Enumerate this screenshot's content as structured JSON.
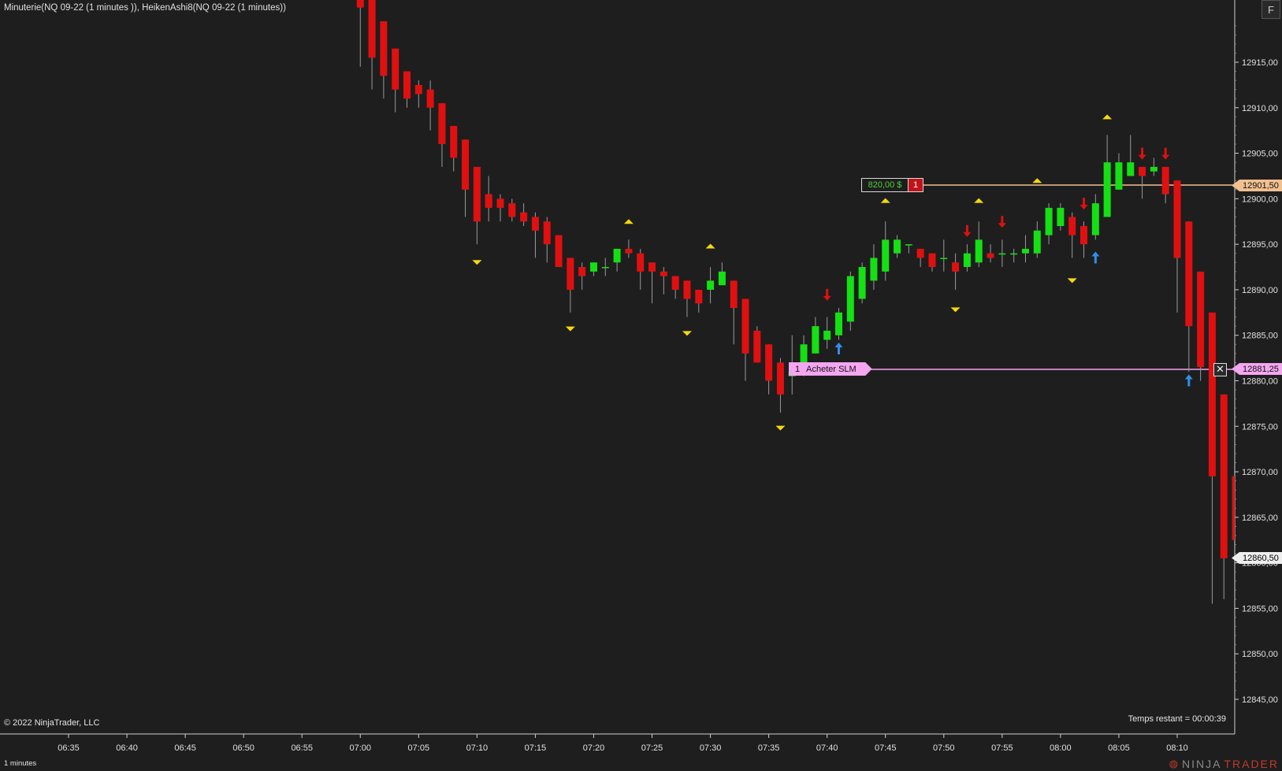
{
  "header": {
    "title": "Minuterie(NQ 09-22 (1 minutes )), HeikenAshi8(NQ 09-22 (1 minutes))",
    "f_button": "F"
  },
  "footer": {
    "copyright": "© 2022 NinjaTrader, LLC",
    "remaining": "Temps restant = 00:00:39",
    "interval": "1 minutes",
    "brand_ninja": "NINJA",
    "brand_trader": "TRADER"
  },
  "position": {
    "pnl": "820,00 $",
    "qty": "1",
    "price": 12901.5,
    "price_label": "12901,50"
  },
  "order": {
    "qty": "1",
    "label": "Acheter SLM",
    "price": 12881.25,
    "price_label": "12881,25"
  },
  "last_price": {
    "price": 12860.5,
    "label": "12860,50"
  },
  "colors": {
    "background": "#1e1e1e",
    "up": "#14e014",
    "down": "#e01010",
    "wick": "#9a9a9a",
    "position_line": "#f0c090",
    "order_line": "#f4a6f0",
    "marker_yellow": "#f5d90a",
    "arrow_blue": "#2f8ff0",
    "arrow_red": "#e01010"
  },
  "chart_data": {
    "type": "candlestick",
    "ylim": [
      12841,
      12922
    ],
    "y_ticks": [
      "12915,00",
      "12910,00",
      "12905,00",
      "12900,00",
      "12895,00",
      "12890,00",
      "12885,00",
      "12880,00",
      "12875,00",
      "12870,00",
      "12865,00",
      "12860,00",
      "12855,00",
      "12850,00",
      "12845,00"
    ],
    "y_tick_values": [
      12915,
      12910,
      12905,
      12900,
      12895,
      12890,
      12885,
      12880,
      12875,
      12870,
      12865,
      12860,
      12855,
      12850,
      12845
    ],
    "x_ticks": [
      "06:35",
      "06:40",
      "06:45",
      "06:50",
      "06:55",
      "07:00",
      "07:05",
      "07:10",
      "07:15",
      "07:20",
      "07:25",
      "07:30",
      "07:35",
      "07:40",
      "07:45",
      "07:50",
      "07:55",
      "08:00",
      "08:05",
      "08:10"
    ],
    "x_tick_minutes": [
      395,
      400,
      405,
      410,
      415,
      420,
      425,
      430,
      435,
      440,
      445,
      450,
      455,
      460,
      465,
      470,
      475,
      480,
      485,
      490
    ],
    "grid": false,
    "candles": [
      {
        "t": 420,
        "o": 12925.0,
        "h": 12925.0,
        "l": 12914.5,
        "c": 12921.0
      },
      {
        "t": 421,
        "o": 12925.0,
        "h": 12925.0,
        "l": 12912.0,
        "c": 12915.5
      },
      {
        "t": 422,
        "o": 12919.5,
        "h": 12919.5,
        "l": 12911.0,
        "c": 12913.5
      },
      {
        "t": 423,
        "o": 12916.5,
        "h": 12916.5,
        "l": 12909.5,
        "c": 12912.0
      },
      {
        "t": 424,
        "o": 12914.0,
        "h": 12914.0,
        "l": 12910.0,
        "c": 12911.0
      },
      {
        "t": 425,
        "o": 12912.5,
        "h": 12913.0,
        "l": 12910.0,
        "c": 12911.5
      },
      {
        "t": 426,
        "o": 12912.0,
        "h": 12913.0,
        "l": 12907.5,
        "c": 12910.0
      },
      {
        "t": 427,
        "o": 12910.5,
        "h": 12910.5,
        "l": 12903.5,
        "c": 12906.0
      },
      {
        "t": 428,
        "o": 12908.0,
        "h": 12908.0,
        "l": 12903.0,
        "c": 12904.5
      },
      {
        "t": 429,
        "o": 12906.5,
        "h": 12906.5,
        "l": 12898.0,
        "c": 12901.0
      },
      {
        "t": 430,
        "o": 12903.5,
        "h": 12903.5,
        "l": 12895.0,
        "c": 12897.5
      },
      {
        "t": 431,
        "o": 12900.5,
        "h": 12902.5,
        "l": 12897.5,
        "c": 12899.0
      },
      {
        "t": 432,
        "o": 12900.0,
        "h": 12900.5,
        "l": 12897.5,
        "c": 12899.0
      },
      {
        "t": 433,
        "o": 12899.5,
        "h": 12900.0,
        "l": 12897.5,
        "c": 12898.0
      },
      {
        "t": 434,
        "o": 12898.5,
        "h": 12899.5,
        "l": 12897.0,
        "c": 12897.5
      },
      {
        "t": 435,
        "o": 12898.0,
        "h": 12898.5,
        "l": 12893.5,
        "c": 12896.5
      },
      {
        "t": 436,
        "o": 12897.5,
        "h": 12898.0,
        "l": 12893.0,
        "c": 12895.0
      },
      {
        "t": 437,
        "o": 12896.0,
        "h": 12896.0,
        "l": 12892.5,
        "c": 12892.5
      },
      {
        "t": 438,
        "o": 12893.5,
        "h": 12893.5,
        "l": 12887.5,
        "c": 12890.0
      },
      {
        "t": 439,
        "o": 12892.5,
        "h": 12893.0,
        "l": 12890.0,
        "c": 12891.5
      },
      {
        "t": 440,
        "o": 12892.0,
        "h": 12893.0,
        "l": 12891.5,
        "c": 12893.0
      },
      {
        "t": 441,
        "o": 12892.5,
        "h": 12893.5,
        "l": 12891.5,
        "c": 12892.5
      },
      {
        "t": 442,
        "o": 12893.0,
        "h": 12894.5,
        "l": 12892.0,
        "c": 12894.5
      },
      {
        "t": 443,
        "o": 12894.5,
        "h": 12895.5,
        "l": 12893.5,
        "c": 12894.0
      },
      {
        "t": 444,
        "o": 12894.0,
        "h": 12894.5,
        "l": 12890.0,
        "c": 12892.0
      },
      {
        "t": 445,
        "o": 12893.0,
        "h": 12893.0,
        "l": 12888.5,
        "c": 12892.0
      },
      {
        "t": 446,
        "o": 12892.0,
        "h": 12892.5,
        "l": 12889.5,
        "c": 12891.5
      },
      {
        "t": 447,
        "o": 12891.5,
        "h": 12891.5,
        "l": 12889.0,
        "c": 12890.0
      },
      {
        "t": 448,
        "o": 12891.0,
        "h": 12891.0,
        "l": 12887.0,
        "c": 12889.0
      },
      {
        "t": 449,
        "o": 12890.0,
        "h": 12890.0,
        "l": 12887.5,
        "c": 12888.5
      },
      {
        "t": 450,
        "o": 12890.0,
        "h": 12892.5,
        "l": 12888.5,
        "c": 12891.0
      },
      {
        "t": 451,
        "o": 12890.5,
        "h": 12893.0,
        "l": 12890.5,
        "c": 12892.0
      },
      {
        "t": 452,
        "o": 12891.0,
        "h": 12891.0,
        "l": 12884.0,
        "c": 12888.0
      },
      {
        "t": 453,
        "o": 12889.0,
        "h": 12889.0,
        "l": 12880.0,
        "c": 12883.0
      },
      {
        "t": 454,
        "o": 12885.5,
        "h": 12886.0,
        "l": 12882.0,
        "c": 12882.0
      },
      {
        "t": 455,
        "o": 12884.0,
        "h": 12884.0,
        "l": 12878.5,
        "c": 12880.0
      },
      {
        "t": 456,
        "o": 12882.0,
        "h": 12882.5,
        "l": 12876.5,
        "c": 12878.5
      },
      {
        "t": 457,
        "o": 12880.5,
        "h": 12885.0,
        "l": 12878.5,
        "c": 12881.0
      },
      {
        "t": 458,
        "o": 12881.0,
        "h": 12885.0,
        "l": 12880.5,
        "c": 12884.0
      },
      {
        "t": 459,
        "o": 12883.0,
        "h": 12887.0,
        "l": 12883.0,
        "c": 12886.0
      },
      {
        "t": 460,
        "o": 12884.5,
        "h": 12887.0,
        "l": 12883.5,
        "c": 12885.5
      },
      {
        "t": 461,
        "o": 12885.0,
        "h": 12888.0,
        "l": 12884.5,
        "c": 12887.5
      },
      {
        "t": 462,
        "o": 12886.5,
        "h": 12892.0,
        "l": 12885.5,
        "c": 12891.5
      },
      {
        "t": 463,
        "o": 12889.0,
        "h": 12893.0,
        "l": 12888.5,
        "c": 12892.5
      },
      {
        "t": 464,
        "o": 12891.0,
        "h": 12895.0,
        "l": 12890.0,
        "c": 12893.5
      },
      {
        "t": 465,
        "o": 12892.0,
        "h": 12897.5,
        "l": 12891.0,
        "c": 12895.5
      },
      {
        "t": 466,
        "o": 12894.0,
        "h": 12896.0,
        "l": 12893.5,
        "c": 12895.5
      },
      {
        "t": 467,
        "o": 12895.0,
        "h": 12895.0,
        "l": 12894.0,
        "c": 12895.0
      },
      {
        "t": 468,
        "o": 12894.5,
        "h": 12894.5,
        "l": 12892.5,
        "c": 12893.5
      },
      {
        "t": 469,
        "o": 12894.0,
        "h": 12894.0,
        "l": 12892.0,
        "c": 12892.5
      },
      {
        "t": 470,
        "o": 12893.5,
        "h": 12895.5,
        "l": 12892.0,
        "c": 12893.5
      },
      {
        "t": 471,
        "o": 12893.0,
        "h": 12894.0,
        "l": 12890.0,
        "c": 12892.0
      },
      {
        "t": 472,
        "o": 12892.5,
        "h": 12895.0,
        "l": 12892.0,
        "c": 12894.0
      },
      {
        "t": 473,
        "o": 12893.0,
        "h": 12897.5,
        "l": 12892.5,
        "c": 12895.5
      },
      {
        "t": 474,
        "o": 12894.0,
        "h": 12895.0,
        "l": 12893.0,
        "c": 12893.5
      },
      {
        "t": 475,
        "o": 12894.0,
        "h": 12895.5,
        "l": 12892.5,
        "c": 12894.0
      },
      {
        "t": 476,
        "o": 12894.0,
        "h": 12894.5,
        "l": 12893.0,
        "c": 12894.0
      },
      {
        "t": 477,
        "o": 12894.0,
        "h": 12896.0,
        "l": 12893.0,
        "c": 12894.5
      },
      {
        "t": 478,
        "o": 12894.0,
        "h": 12897.5,
        "l": 12893.5,
        "c": 12896.5
      },
      {
        "t": 479,
        "o": 12896.0,
        "h": 12899.5,
        "l": 12895.0,
        "c": 12899.0
      },
      {
        "t": 480,
        "o": 12897.0,
        "h": 12899.5,
        "l": 12896.5,
        "c": 12899.0
      },
      {
        "t": 481,
        "o": 12898.0,
        "h": 12898.5,
        "l": 12893.5,
        "c": 12896.0
      },
      {
        "t": 482,
        "o": 12897.0,
        "h": 12897.5,
        "l": 12893.5,
        "c": 12895.0
      },
      {
        "t": 483,
        "o": 12896.0,
        "h": 12900.5,
        "l": 12895.5,
        "c": 12899.5
      },
      {
        "t": 484,
        "o": 12898.0,
        "h": 12907.0,
        "l": 12898.0,
        "c": 12904.0
      },
      {
        "t": 485,
        "o": 12901.0,
        "h": 12905.0,
        "l": 12901.0,
        "c": 12904.0
      },
      {
        "t": 486,
        "o": 12902.5,
        "h": 12907.0,
        "l": 12902.5,
        "c": 12904.0
      },
      {
        "t": 487,
        "o": 12903.5,
        "h": 12903.5,
        "l": 12900.0,
        "c": 12902.5
      },
      {
        "t": 488,
        "o": 12903.0,
        "h": 12904.5,
        "l": 12902.5,
        "c": 12903.5
      },
      {
        "t": 489,
        "o": 12903.5,
        "h": 12903.5,
        "l": 12899.5,
        "c": 12900.5
      },
      {
        "t": 490,
        "o": 12902.0,
        "h": 12902.0,
        "l": 12887.5,
        "c": 12893.5
      },
      {
        "t": 491,
        "o": 12897.5,
        "h": 12897.5,
        "l": 12881.0,
        "c": 12886.0
      },
      {
        "t": 492,
        "o": 12892.0,
        "h": 12892.0,
        "l": 12880.0,
        "c": 12881.5
      },
      {
        "t": 493,
        "o": 12887.5,
        "h": 12887.5,
        "l": 12855.5,
        "c": 12869.5
      },
      {
        "t": 494,
        "o": 12878.5,
        "h": 12878.5,
        "l": 12856.0,
        "c": 12860.5
      },
      {
        "t": 495,
        "o": 12869.5,
        "h": 12869.5,
        "l": 12859.5,
        "c": 12862.5
      }
    ],
    "markers_up_yellow": [
      {
        "t": 443,
        "price": 12897.5
      },
      {
        "t": 450,
        "price": 12894.8
      },
      {
        "t": 465,
        "price": 12899.8
      },
      {
        "t": 473,
        "price": 12899.8
      },
      {
        "t": 478,
        "price": 12902.0
      },
      {
        "t": 484,
        "price": 12909.0
      }
    ],
    "markers_down_yellow": [
      {
        "t": 430,
        "price": 12893.0
      },
      {
        "t": 438,
        "price": 12885.7
      },
      {
        "t": 448,
        "price": 12885.2
      },
      {
        "t": 456,
        "price": 12874.8
      },
      {
        "t": 471,
        "price": 12887.8
      },
      {
        "t": 481,
        "price": 12891.0
      }
    ],
    "arrows_up_blue": [
      {
        "t": 461,
        "price": 12883.5
      },
      {
        "t": 483,
        "price": 12893.5
      },
      {
        "t": 491,
        "price": 12880.0
      }
    ],
    "arrows_down_red": [
      {
        "t": 460,
        "price": 12889.5
      },
      {
        "t": 472,
        "price": 12896.5
      },
      {
        "t": 475,
        "price": 12897.5
      },
      {
        "t": 482,
        "price": 12899.5
      },
      {
        "t": 487,
        "price": 12905.0
      },
      {
        "t": 489,
        "price": 12905.0
      }
    ]
  }
}
